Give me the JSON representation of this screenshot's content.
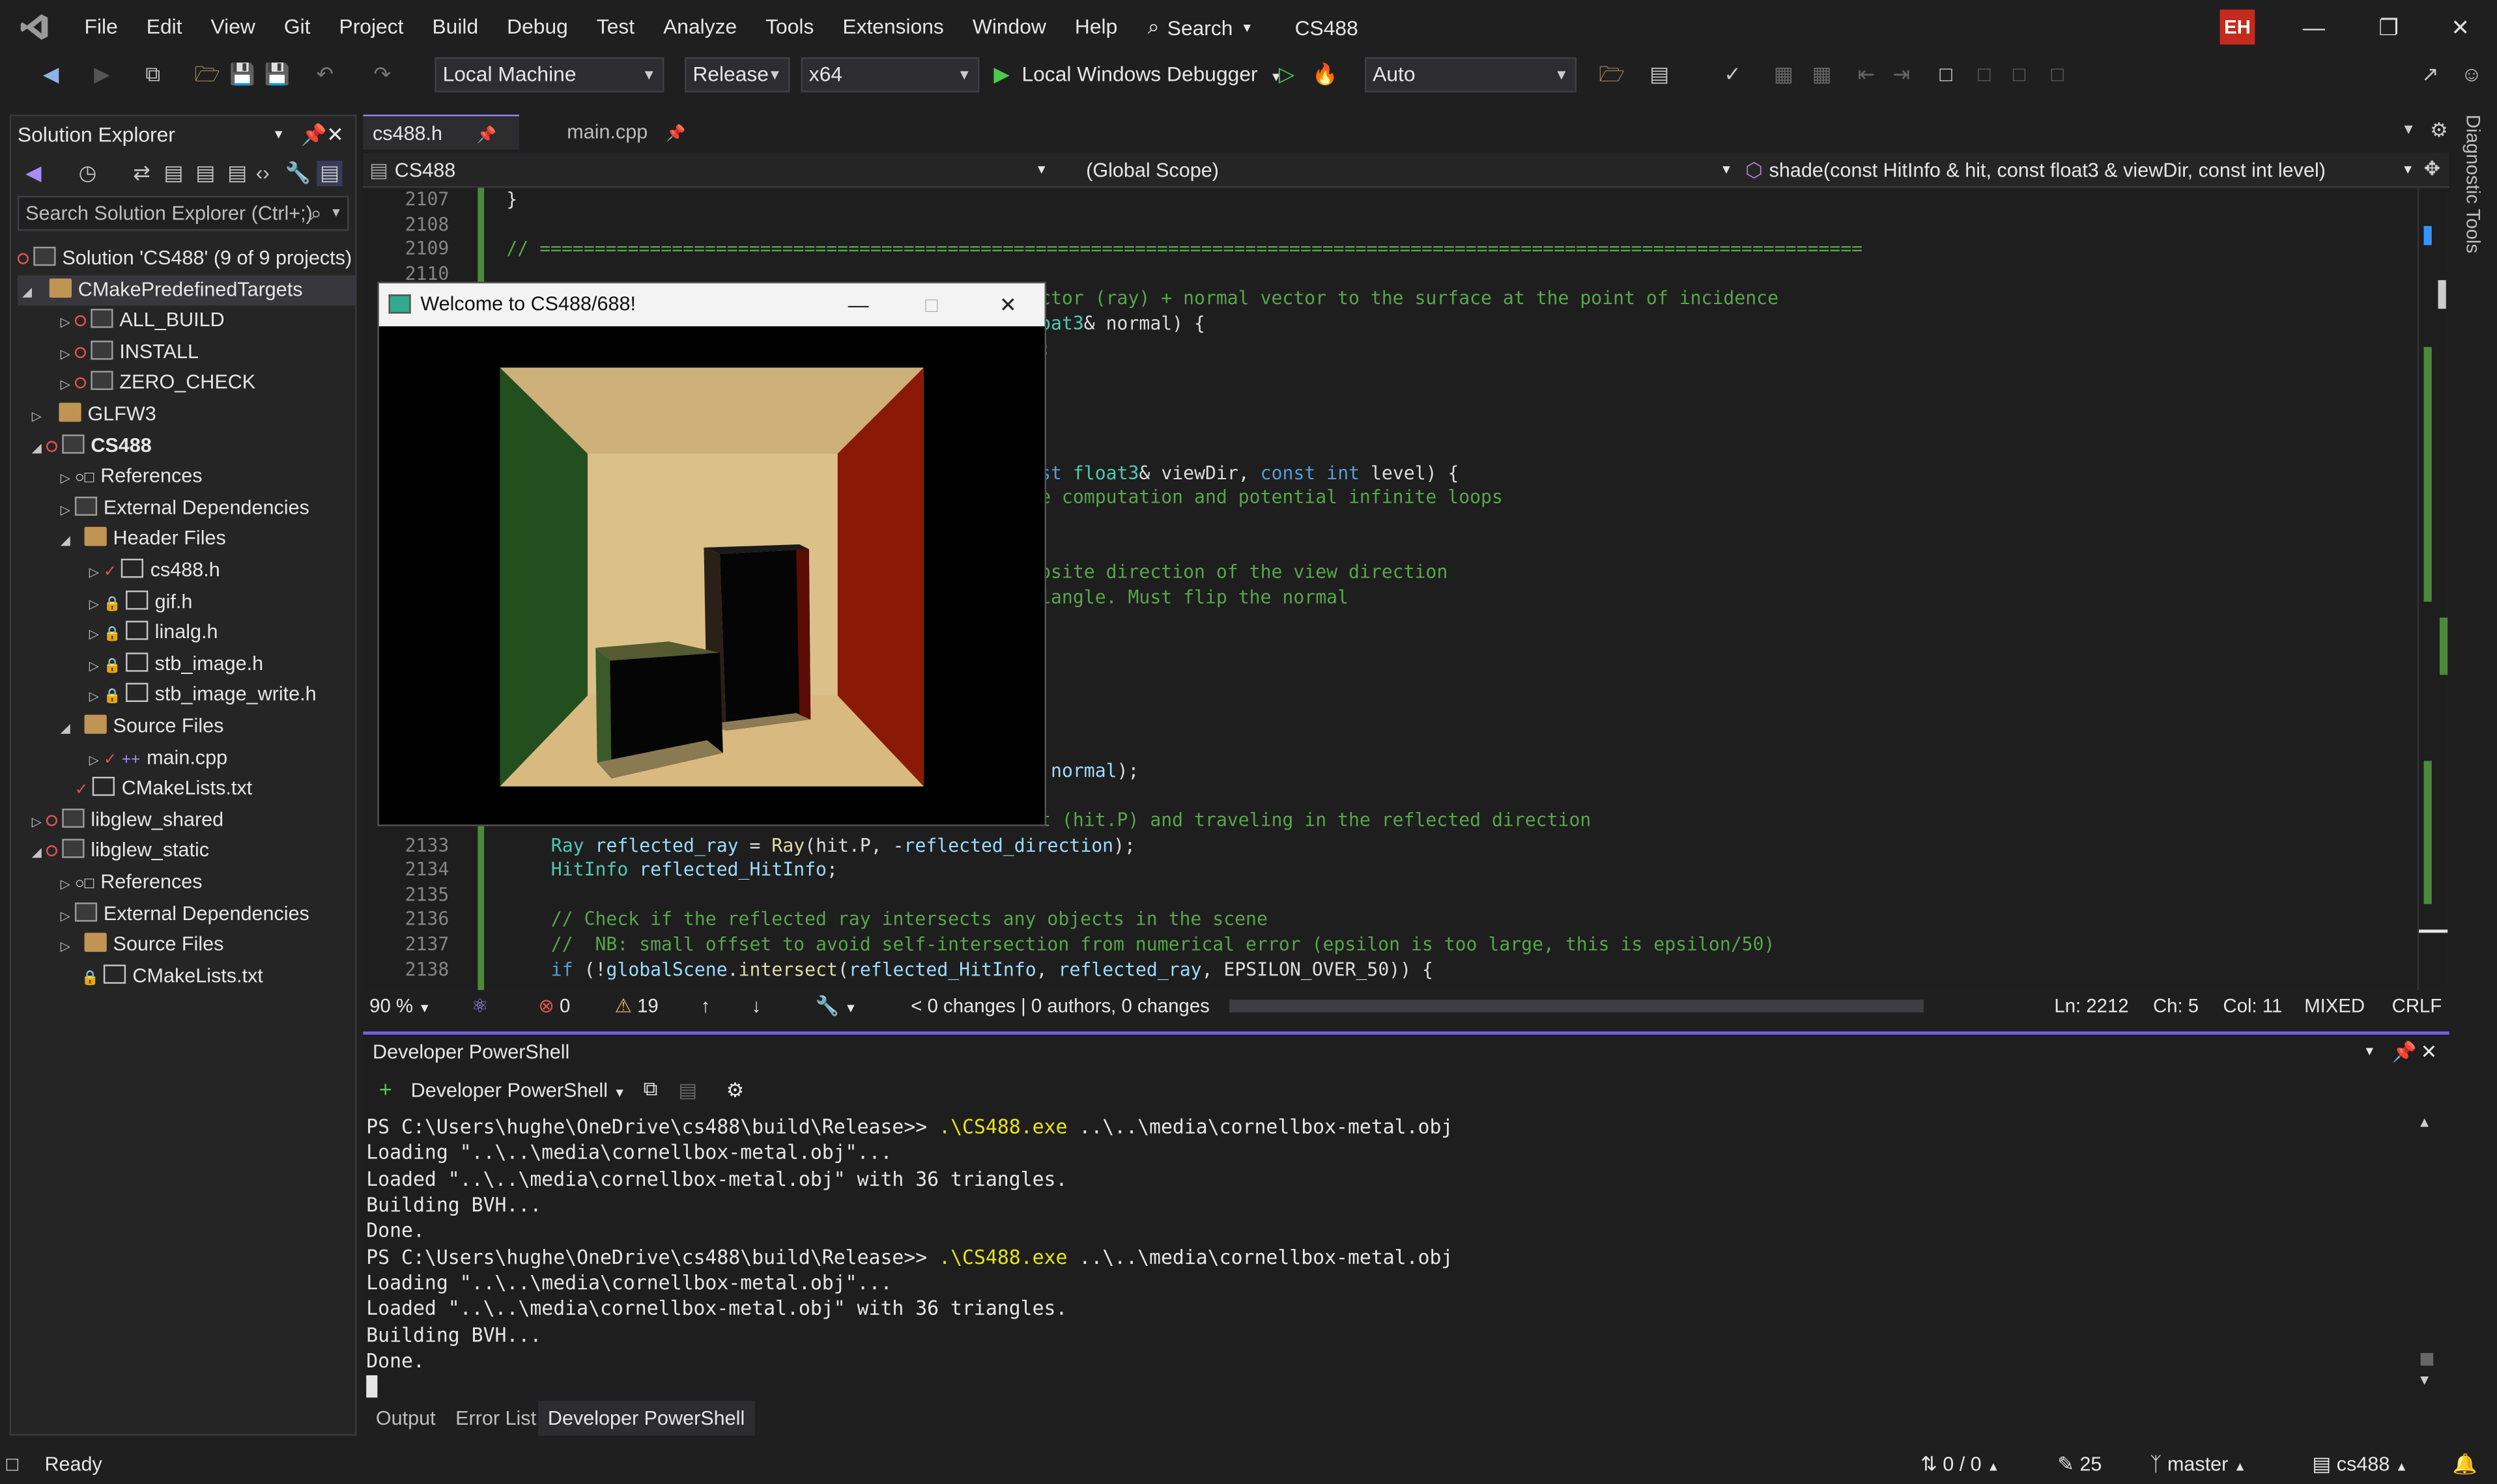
{
  "menu": [
    "File",
    "Edit",
    "View",
    "Git",
    "Project",
    "Build",
    "Debug",
    "Test",
    "Analyze",
    "Tools",
    "Extensions",
    "Window",
    "Help"
  ],
  "search_label": "Search",
  "app_title": "CS488",
  "user_initials": "EH",
  "toolbar": {
    "target": "Local Machine",
    "config": "Release",
    "platform": "x64",
    "debugger": "Local Windows Debugger",
    "auto": "Auto"
  },
  "solution_explorer": {
    "title": "Solution Explorer",
    "search_placeholder": "Search Solution Explorer (Ctrl+;)",
    "items": [
      {
        "label": "Solution 'CS488' (9 of 9 projects)"
      },
      {
        "label": "CMakePredefinedTargets"
      },
      {
        "label": "ALL_BUILD"
      },
      {
        "label": "INSTALL"
      },
      {
        "label": "ZERO_CHECK"
      },
      {
        "label": "GLFW3"
      },
      {
        "label": "CS488"
      },
      {
        "label": "References"
      },
      {
        "label": "External Dependencies"
      },
      {
        "label": "Header Files"
      },
      {
        "label": "cs488.h"
      },
      {
        "label": "gif.h"
      },
      {
        "label": "linalg.h"
      },
      {
        "label": "stb_image.h"
      },
      {
        "label": "stb_image_write.h"
      },
      {
        "label": "Source Files"
      },
      {
        "label": "main.cpp"
      },
      {
        "label": "CMakeLists.txt"
      },
      {
        "label": "libglew_shared"
      },
      {
        "label": "libglew_static"
      },
      {
        "label": "References"
      },
      {
        "label": "External Dependencies"
      },
      {
        "label": "Source Files"
      },
      {
        "label": "CMakeLists.txt"
      }
    ]
  },
  "editor": {
    "tabs": [
      "cs488.h",
      "main.cpp"
    ],
    "nav_project": "CS488",
    "nav_scope": "(Global Scope)",
    "nav_function": "shade(const HitInfo & hit, const float3 & viewDir, const int level)",
    "zoom": "90 %",
    "errors": "0",
    "warnings": "19",
    "changes": "0 changes | 0 authors, 0 changes",
    "ln": "Ln: 2212",
    "ch": "Ch: 5",
    "col": "Col: 11",
    "encoding": "MIXED",
    "eol": "CRLF"
  },
  "popup": {
    "title": "Welcome to CS488/688!"
  },
  "powershell": {
    "title": "Developer PowerShell",
    "dropdown": "Developer PowerShell",
    "prompt": "PS C:\\Users\\hughe\\OneDrive\\cs488\\build\\Release>> ",
    "command": ".\\CS488.exe",
    "arg": " ..\\..\\media\\cornellbox-metal.obj",
    "out1": "Loading \"..\\..\\media\\cornellbox-metal.obj\"...",
    "out2": "Loaded \"..\\..\\media\\cornellbox-metal.obj\" with 36 triangles.",
    "out3": "Building BVH...",
    "out4": "Done."
  },
  "bottom_tabs": [
    "Output",
    "Error List",
    "Developer PowerShell"
  ],
  "statusbar": {
    "ready": "Ready",
    "sync": "0 / 0",
    "edits": "25",
    "branch": "master",
    "repo": "cs488"
  },
  "diagnostic_tools": "Diagnostic Tools",
  "colors": {
    "accent": "#7160e8",
    "comment": "#57a64a",
    "keyword": "#569cd6"
  }
}
